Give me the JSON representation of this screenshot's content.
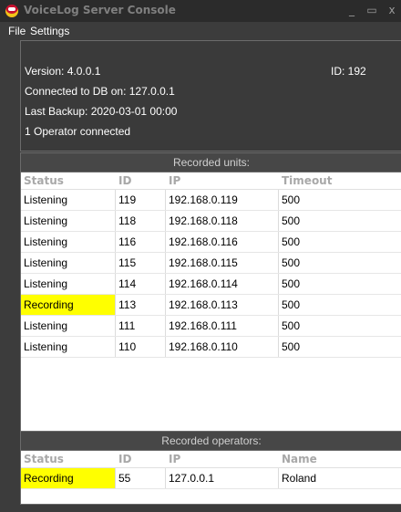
{
  "window": {
    "title": "VoiceLog Server Console",
    "minimize": "_",
    "maximize": "▭",
    "close": "x"
  },
  "menu": {
    "items": [
      "File",
      "Settings"
    ]
  },
  "info": {
    "version": "Version: 4.0.0.1",
    "id": "ID: 192",
    "connected": "Connected to DB on: 127.0.0.1",
    "last_backup": "Last Backup: 2020-03-01 00:00",
    "operators": "1 Operator connected"
  },
  "units": {
    "header": "Recorded units:",
    "columns": [
      "Status",
      "ID",
      "IP",
      "Timeout"
    ],
    "rows": [
      {
        "status": "Listening",
        "id": "119",
        "ip": "192.168.0.119",
        "timeout": "500"
      },
      {
        "status": "Listening",
        "id": "118",
        "ip": "192.168.0.118",
        "timeout": "500"
      },
      {
        "status": "Listening",
        "id": "116",
        "ip": "192.168.0.116",
        "timeout": "500"
      },
      {
        "status": "Listening",
        "id": "115",
        "ip": "192.168.0.115",
        "timeout": "500"
      },
      {
        "status": "Listening",
        "id": "114",
        "ip": "192.168.0.114",
        "timeout": "500"
      },
      {
        "status": "Recording",
        "id": "113",
        "ip": "192.168.0.113",
        "timeout": "500"
      },
      {
        "status": "Listening",
        "id": "111",
        "ip": "192.168.0.111",
        "timeout": "500"
      },
      {
        "status": "Listening",
        "id": "110",
        "ip": "192.168.0.110",
        "timeout": "500"
      }
    ]
  },
  "operators": {
    "header": "Recorded operators:",
    "columns": [
      "Status",
      "ID",
      "IP",
      "Name"
    ],
    "rows": [
      {
        "status": "Recording",
        "id": "55",
        "ip": "127.0.0.1",
        "name": "Roland"
      }
    ]
  },
  "colors": {
    "recording_highlight": "#ffff00",
    "window_bg": "#3c3c3c"
  }
}
